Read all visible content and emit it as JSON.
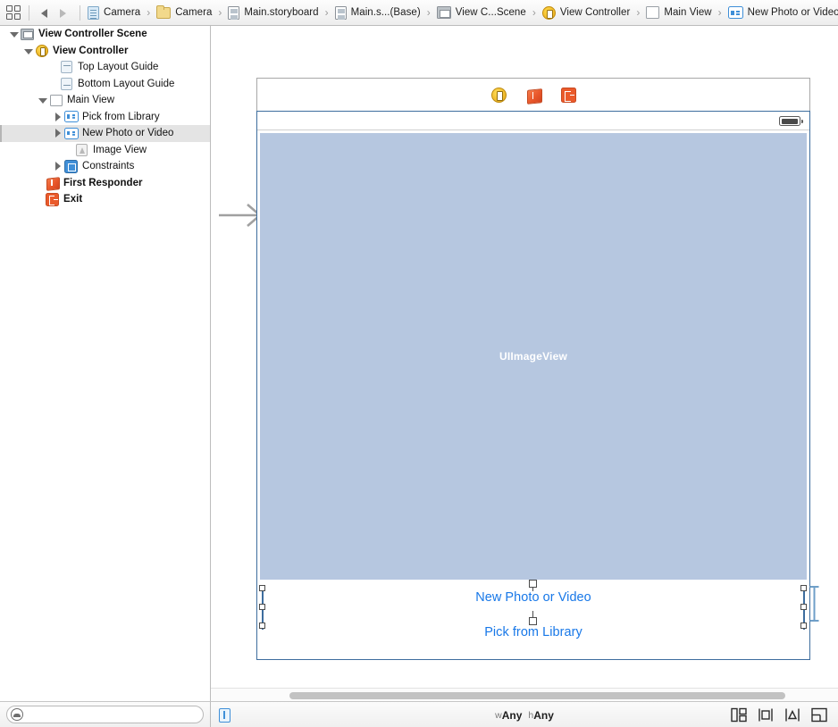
{
  "jumpbar": {
    "grid_icon": "grid-view-icon",
    "back_arrow": "back-arrow-icon",
    "forward_arrow": "forward-arrow-icon",
    "crumbs": [
      {
        "label": "Camera",
        "icon": "project-document-icon"
      },
      {
        "label": "Camera",
        "icon": "folder-icon"
      },
      {
        "label": "Main.storyboard",
        "icon": "storyboard-file-icon"
      },
      {
        "label": "Main.s...(Base)",
        "icon": "storyboard-file-icon"
      },
      {
        "label": "View C...Scene",
        "icon": "scene-icon"
      },
      {
        "label": "View Controller",
        "icon": "view-controller-icon"
      },
      {
        "label": "Main View",
        "icon": "view-icon"
      },
      {
        "label": "New Photo or Video",
        "icon": "button-icon"
      }
    ],
    "chevron": "›"
  },
  "outline": {
    "items": [
      {
        "label": "View Controller Scene",
        "indent": 0,
        "disclosure": "open",
        "icon": "scene-icon",
        "bold": true,
        "selected": false
      },
      {
        "label": "View Controller",
        "indent": 1,
        "disclosure": "open",
        "icon": "view-controller-icon",
        "bold": true,
        "selected": false
      },
      {
        "label": "Top Layout Guide",
        "indent": 2,
        "disclosure": "none",
        "icon": "top-layout-guide-icon",
        "bold": false,
        "selected": false
      },
      {
        "label": "Bottom Layout Guide",
        "indent": 2,
        "disclosure": "none",
        "icon": "bottom-layout-guide-icon",
        "bold": false,
        "selected": false
      },
      {
        "label": "Main View",
        "indent": 2,
        "disclosure": "open",
        "icon": "view-icon",
        "bold": false,
        "selected": false
      },
      {
        "label": "Pick from Library",
        "indent": 3,
        "disclosure": "closed",
        "icon": "button-icon",
        "bold": false,
        "selected": false
      },
      {
        "label": "New Photo or Video",
        "indent": 3,
        "disclosure": "closed",
        "icon": "button-icon",
        "bold": false,
        "selected": true
      },
      {
        "label": "Image View",
        "indent": 3,
        "disclosure": "none",
        "icon": "image-view-icon",
        "bold": false,
        "selected": false
      },
      {
        "label": "Constraints",
        "indent": 3,
        "disclosure": "closed",
        "icon": "constraints-icon",
        "bold": false,
        "selected": false
      },
      {
        "label": "First Responder",
        "indent": 1,
        "disclosure": "none",
        "icon": "first-responder-icon",
        "bold": true,
        "selected": false
      },
      {
        "label": "Exit",
        "indent": 1,
        "disclosure": "none",
        "icon": "exit-icon",
        "bold": true,
        "selected": false
      }
    ]
  },
  "canvas": {
    "entry_arrow": "initial-view-controller-arrow",
    "dock": {
      "view_controller": "view-controller-dock-icon",
      "first_responder": "first-responder-dock-icon",
      "exit": "exit-dock-icon"
    },
    "status_bar": {
      "battery": "battery-icon"
    },
    "image_view": {
      "label": "UIImageView",
      "fill_color": "#b6c7e0",
      "text_color": "#ffffff"
    },
    "buttons": [
      {
        "label": "New Photo or Video",
        "color": "#1878e8",
        "selected": true
      },
      {
        "label": "Pick from Library",
        "color": "#1878e8",
        "selected": false
      }
    ],
    "selection_color": "#3d6d9e"
  },
  "bottom": {
    "filter": {
      "placeholder": "",
      "value": "",
      "icon": "filter-icon"
    },
    "size_class": {
      "icon": "size-class-icon",
      "width_prefix": "w",
      "width_value": "Any",
      "height_prefix": "h",
      "height_value": "Any"
    },
    "autolayout_tools": [
      {
        "name": "stack-button",
        "label": "Stack"
      },
      {
        "name": "align-button",
        "label": "Align"
      },
      {
        "name": "pin-button",
        "label": "Pin"
      },
      {
        "name": "resolve-button",
        "label": "Resolve Auto Layout Issues"
      }
    ]
  }
}
